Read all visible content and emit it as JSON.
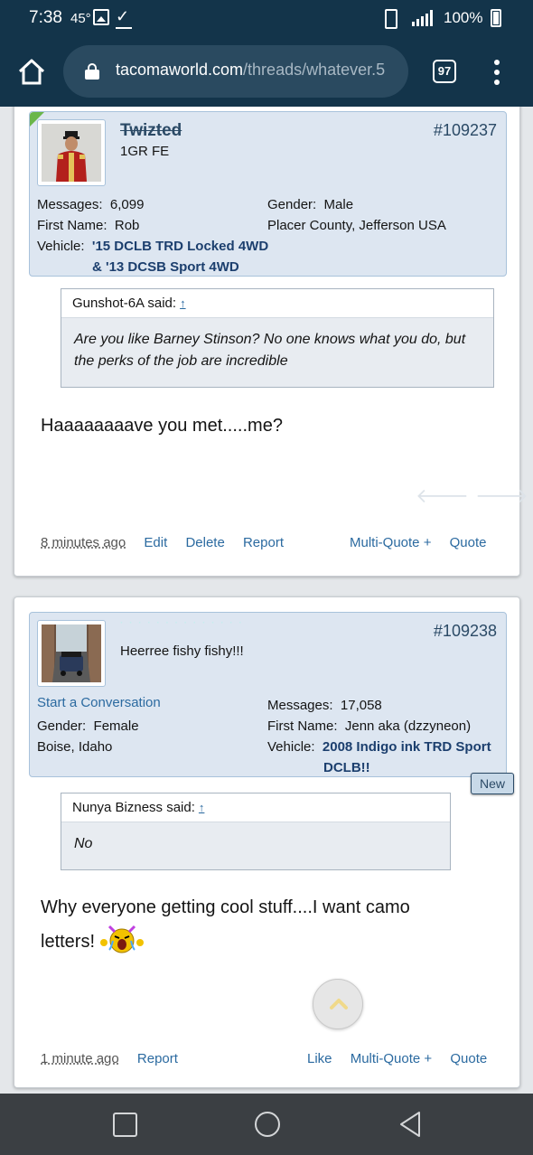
{
  "status_bar": {
    "time": "7:38",
    "temperature": "45°",
    "battery": "100%"
  },
  "browser": {
    "url_domain": "tacomaworld.com",
    "url_path": "/threads/whatever.5",
    "tab_count": "97"
  },
  "posts": [
    {
      "username": "Twizted",
      "user_title": "1GR FE",
      "post_number": "#109237",
      "info_left": [
        {
          "label": "Messages:",
          "value": "6,099"
        },
        {
          "label": "First Name:",
          "value": "Rob"
        },
        {
          "label": "Vehicle:",
          "value": "'15 DCLB TRD Locked 4WD"
        }
      ],
      "vehicle_line2": "& '13 DCSB Sport 4WD",
      "info_right": [
        {
          "label": "Gender:",
          "value": "Male"
        },
        {
          "value": "Placer County, Jefferson USA"
        }
      ],
      "quote_author": "Gunshot-6A said:",
      "quote_arrow": "↑",
      "quote_text": "Are you like Barney Stinson? No one knows what you do, but the perks of the job are incredible",
      "message": "Haaaaaaaave you met.....me?",
      "time": "8 minutes ago",
      "actions_left": [
        "Edit",
        "Delete",
        "Report"
      ],
      "actions_right": [
        "Multi-Quote +",
        "Quote"
      ]
    },
    {
      "username": "· · · · · · · · · · · · · ·",
      "user_title": "Heerree fishy fishy!!!",
      "post_number": "#109238",
      "start_conversation": "Start a Conversation",
      "info_left": [
        {
          "label": "Gender:",
          "value": "Female"
        },
        {
          "value": "Boise, Idaho"
        }
      ],
      "info_right": [
        {
          "label": "Messages:",
          "value": "17,058"
        },
        {
          "label": "First Name:",
          "value": "Jenn aka (dzzyneon)"
        },
        {
          "label": "Vehicle:",
          "value": "2008 Indigo ink TRD Sport"
        }
      ],
      "vehicle_line2": "DCLB!!",
      "new_badge": "New",
      "quote_author": "Nunya Bizness said:",
      "quote_arrow": "↑",
      "quote_text": "No",
      "message_line1": "Why everyone getting cool stuff....I want camo",
      "message_line2": "letters!",
      "time": "1 minute ago",
      "actions_left": [
        "Report"
      ],
      "actions_right": [
        "Like",
        "Multi-Quote +",
        "Quote"
      ]
    }
  ]
}
